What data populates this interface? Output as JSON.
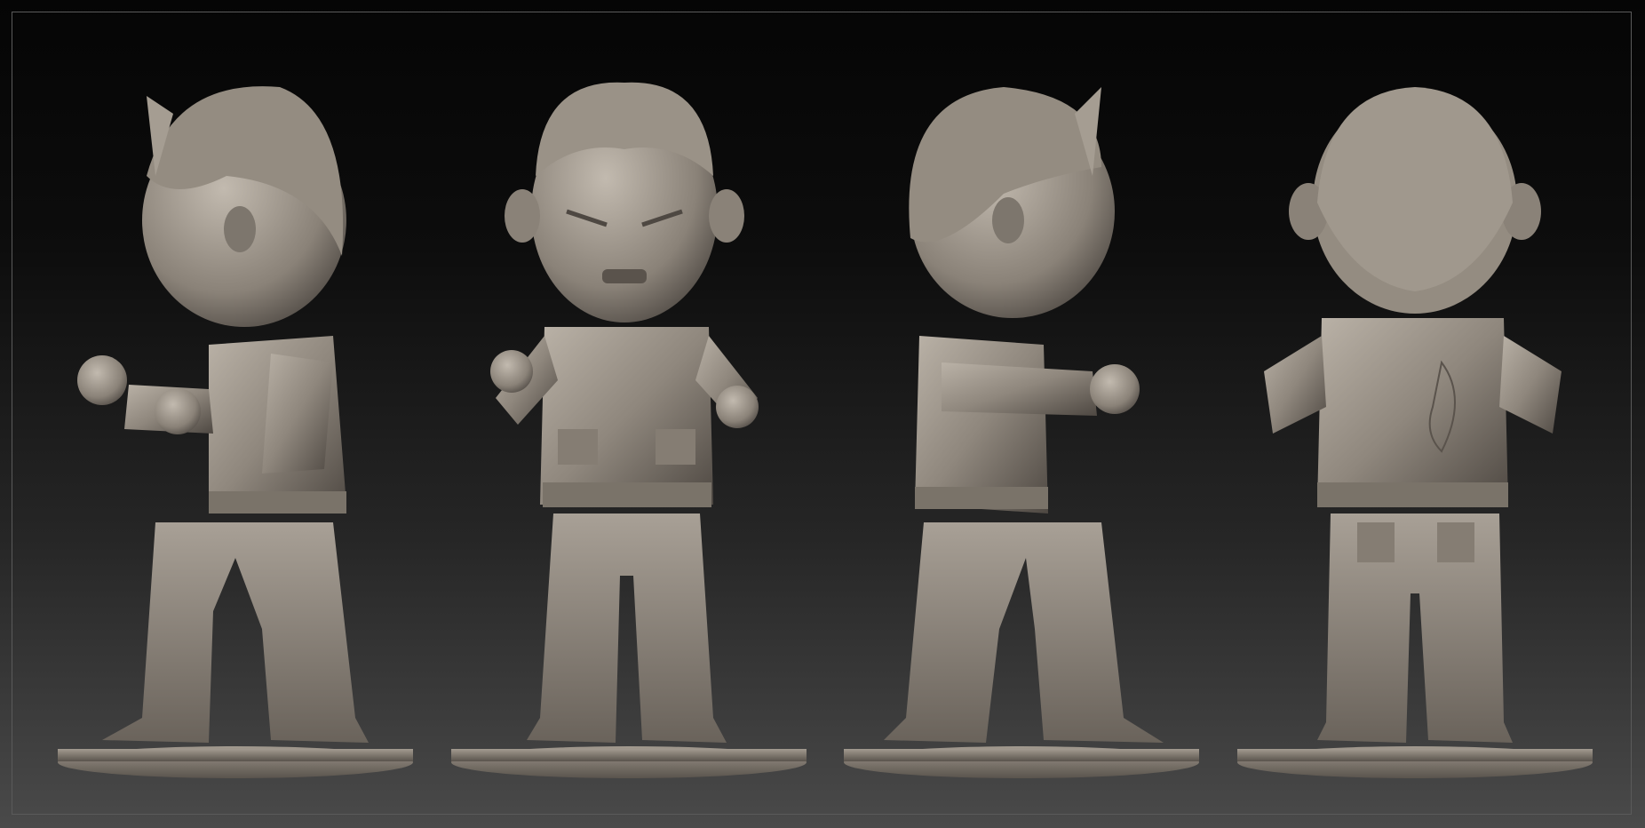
{
  "viewport": {
    "background_top": "#050505",
    "background_bottom": "#4a4a4a",
    "frame_color": "#5a5a5a"
  },
  "sculpt": {
    "material_color": "#8f877d",
    "highlight_color": "#b8b0a5",
    "shadow_color": "#4e4842",
    "views": [
      {
        "name": "left-side-view"
      },
      {
        "name": "front-view"
      },
      {
        "name": "right-side-view"
      },
      {
        "name": "back-view"
      }
    ]
  }
}
